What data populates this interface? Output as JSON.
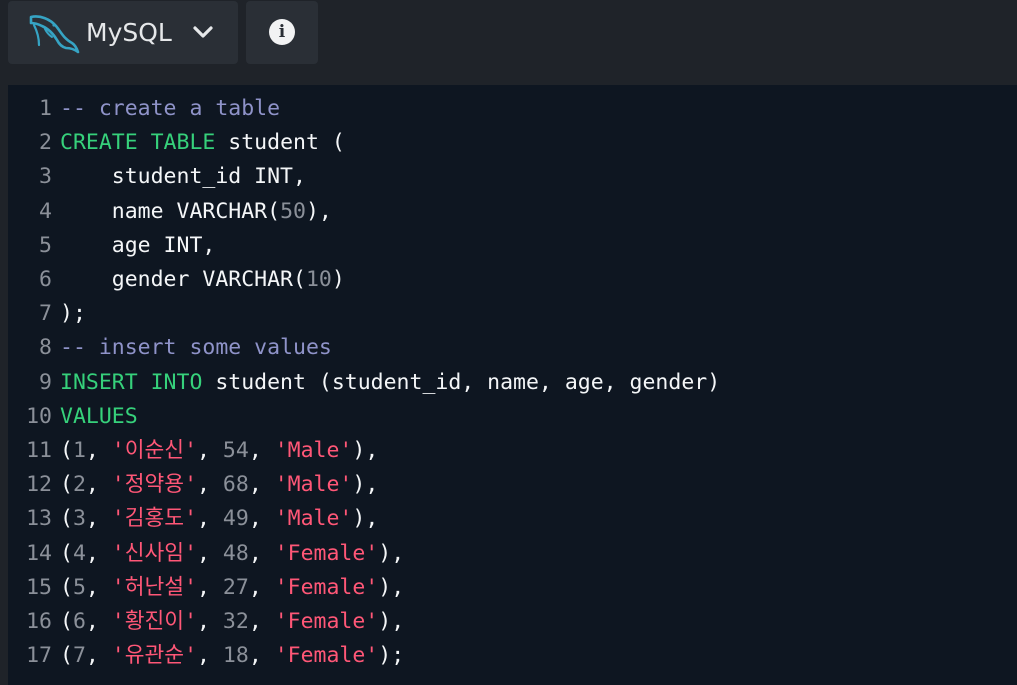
{
  "toolbar": {
    "database_label": "MySQL",
    "database_icon": "mysql-dolphin-icon",
    "dropdown_icon": "chevron-down-icon",
    "info_icon": "info-icon",
    "info_glyph": "i"
  },
  "editor": {
    "lines": [
      {
        "num": "1",
        "tokens": [
          {
            "t": "cm",
            "v": "-- create a table"
          }
        ]
      },
      {
        "num": "2",
        "tokens": [
          {
            "t": "kw",
            "v": "CREATE TABLE"
          },
          {
            "t": "tx",
            "v": " student ("
          }
        ]
      },
      {
        "num": "3",
        "tokens": [
          {
            "t": "tx",
            "v": "    student_id INT,"
          }
        ]
      },
      {
        "num": "4",
        "tokens": [
          {
            "t": "tx",
            "v": "    name VARCHAR("
          },
          {
            "t": "nu",
            "v": "50"
          },
          {
            "t": "tx",
            "v": "),"
          }
        ]
      },
      {
        "num": "5",
        "tokens": [
          {
            "t": "tx",
            "v": "    age INT,"
          }
        ]
      },
      {
        "num": "6",
        "tokens": [
          {
            "t": "tx",
            "v": "    gender VARCHAR("
          },
          {
            "t": "nu",
            "v": "10"
          },
          {
            "t": "tx",
            "v": ")"
          }
        ]
      },
      {
        "num": "7",
        "tokens": [
          {
            "t": "tx",
            "v": ");"
          }
        ]
      },
      {
        "num": "8",
        "tokens": [
          {
            "t": "cm",
            "v": "-- insert some values"
          }
        ]
      },
      {
        "num": "9",
        "tokens": [
          {
            "t": "kw",
            "v": "INSERT INTO"
          },
          {
            "t": "tx",
            "v": " student (student_id, name, age, gender)"
          }
        ]
      },
      {
        "num": "10",
        "tokens": [
          {
            "t": "kw",
            "v": "VALUES"
          }
        ]
      },
      {
        "num": "11",
        "tokens": [
          {
            "t": "tx",
            "v": "("
          },
          {
            "t": "nu",
            "v": "1"
          },
          {
            "t": "tx",
            "v": ", "
          },
          {
            "t": "st",
            "v": "'이순신'"
          },
          {
            "t": "tx",
            "v": ", "
          },
          {
            "t": "nu",
            "v": "54"
          },
          {
            "t": "tx",
            "v": ", "
          },
          {
            "t": "st",
            "v": "'Male'"
          },
          {
            "t": "tx",
            "v": "),"
          }
        ]
      },
      {
        "num": "12",
        "tokens": [
          {
            "t": "tx",
            "v": "("
          },
          {
            "t": "nu",
            "v": "2"
          },
          {
            "t": "tx",
            "v": ", "
          },
          {
            "t": "st",
            "v": "'정약용'"
          },
          {
            "t": "tx",
            "v": ", "
          },
          {
            "t": "nu",
            "v": "68"
          },
          {
            "t": "tx",
            "v": ", "
          },
          {
            "t": "st",
            "v": "'Male'"
          },
          {
            "t": "tx",
            "v": "),"
          }
        ]
      },
      {
        "num": "13",
        "tokens": [
          {
            "t": "tx",
            "v": "("
          },
          {
            "t": "nu",
            "v": "3"
          },
          {
            "t": "tx",
            "v": ", "
          },
          {
            "t": "st",
            "v": "'김홍도'"
          },
          {
            "t": "tx",
            "v": ", "
          },
          {
            "t": "nu",
            "v": "49"
          },
          {
            "t": "tx",
            "v": ", "
          },
          {
            "t": "st",
            "v": "'Male'"
          },
          {
            "t": "tx",
            "v": "),"
          }
        ]
      },
      {
        "num": "14",
        "tokens": [
          {
            "t": "tx",
            "v": "("
          },
          {
            "t": "nu",
            "v": "4"
          },
          {
            "t": "tx",
            "v": ", "
          },
          {
            "t": "st",
            "v": "'신사임'"
          },
          {
            "t": "tx",
            "v": ", "
          },
          {
            "t": "nu",
            "v": "48"
          },
          {
            "t": "tx",
            "v": ", "
          },
          {
            "t": "st",
            "v": "'Female'"
          },
          {
            "t": "tx",
            "v": "),"
          }
        ]
      },
      {
        "num": "15",
        "tokens": [
          {
            "t": "tx",
            "v": "("
          },
          {
            "t": "nu",
            "v": "5"
          },
          {
            "t": "tx",
            "v": ", "
          },
          {
            "t": "st",
            "v": "'허난설'"
          },
          {
            "t": "tx",
            "v": ", "
          },
          {
            "t": "nu",
            "v": "27"
          },
          {
            "t": "tx",
            "v": ", "
          },
          {
            "t": "st",
            "v": "'Female'"
          },
          {
            "t": "tx",
            "v": "),"
          }
        ]
      },
      {
        "num": "16",
        "tokens": [
          {
            "t": "tx",
            "v": "("
          },
          {
            "t": "nu",
            "v": "6"
          },
          {
            "t": "tx",
            "v": ", "
          },
          {
            "t": "st",
            "v": "'황진이'"
          },
          {
            "t": "tx",
            "v": ", "
          },
          {
            "t": "nu",
            "v": "32"
          },
          {
            "t": "tx",
            "v": ", "
          },
          {
            "t": "st",
            "v": "'Female'"
          },
          {
            "t": "tx",
            "v": "),"
          }
        ]
      },
      {
        "num": "17",
        "tokens": [
          {
            "t": "tx",
            "v": "("
          },
          {
            "t": "nu",
            "v": "7"
          },
          {
            "t": "tx",
            "v": ", "
          },
          {
            "t": "st",
            "v": "'유관순'"
          },
          {
            "t": "tx",
            "v": ", "
          },
          {
            "t": "nu",
            "v": "18"
          },
          {
            "t": "tx",
            "v": ", "
          },
          {
            "t": "st",
            "v": "'Female'"
          },
          {
            "t": "tx",
            "v": ");"
          }
        ]
      }
    ]
  },
  "colors": {
    "background": "#1f2329",
    "editor_background": "#0e1621",
    "keyword": "#36d17b",
    "comment": "#8f93c9",
    "string": "#ff5777",
    "number": "#8b9099",
    "text": "#f4f6f8",
    "line_number": "#8b9099"
  }
}
